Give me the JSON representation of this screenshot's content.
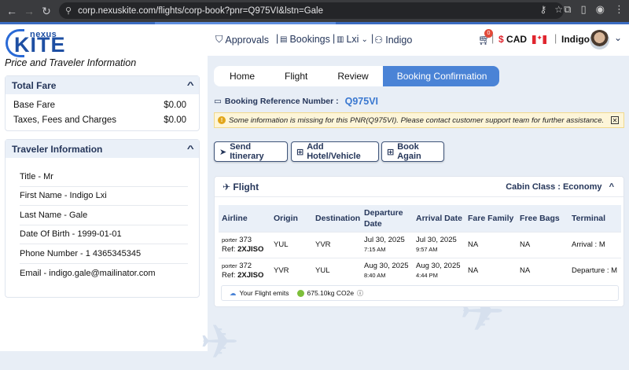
{
  "browser": {
    "url": "corp.nexuskite.com/flights/corp-book?pnr=Q975VI&lstn=Gale"
  },
  "brand": {
    "logo_top": "nexus",
    "logo_main": "KITE"
  },
  "sidebar": {
    "page_title": "Price and Traveler Information",
    "total_fare": {
      "heading": "Total Fare",
      "rows": [
        {
          "label": "Base Fare",
          "value": "$0.00"
        },
        {
          "label": "Taxes, Fees and Charges",
          "value": "$0.00"
        }
      ]
    },
    "traveler": {
      "heading": "Traveler Information",
      "rows": [
        "Title - Mr",
        "First Name - Indigo Lxi",
        "Last Name - Gale",
        "Date Of Birth - 1999-01-01",
        "Phone Number - 1 4365345345",
        "Email - indigo.gale@mailinator.com"
      ]
    }
  },
  "topnav": {
    "approvals": "Approvals",
    "bookings": "Bookings",
    "lxi": "Lxi",
    "indigo": "Indigo",
    "cart_count": "0",
    "currency_symbol": "$",
    "currency": "CAD",
    "user": "Indigo"
  },
  "breadcrumb": [
    "Home",
    "Flight",
    "Review",
    "Booking Confirmation"
  ],
  "booking": {
    "ref_label": "Booking Reference Number :",
    "ref_value": "Q975VI",
    "warning": "Some information is missing for this PNR(Q975VI). Please contact customer support team for further assistance."
  },
  "actions": {
    "send": "Send Itinerary",
    "hotel": "Add Hotel/Vehicle",
    "again": "Book Again"
  },
  "flight": {
    "title": "Flight",
    "cabin": "Cabin Class : Economy",
    "columns": [
      "Airline",
      "Origin",
      "Destination",
      "Departure Date",
      "Arrival Date",
      "Fare Family",
      "Free Bags",
      "Terminal"
    ],
    "rows": [
      {
        "carrier": "porter",
        "number": "373",
        "ref": "Ref:",
        "ref_code": "2XJISO",
        "origin": "YUL",
        "destination": "YVR",
        "dep_date": "Jul 30, 2025",
        "dep_time": "7:15 AM",
        "arr_date": "Jul 30, 2025",
        "arr_time": "9:57 AM",
        "fare": "NA",
        "bags": "NA",
        "terminal": "Arrival : M"
      },
      {
        "carrier": "porter",
        "number": "372",
        "ref": "Ref:",
        "ref_code": "2XJISO",
        "origin": "YVR",
        "destination": "YUL",
        "dep_date": "Aug 30, 2025",
        "dep_time": "8:40 AM",
        "arr_date": "Aug 30, 2025",
        "arr_time": "4:44 PM",
        "fare": "NA",
        "bags": "NA",
        "terminal": "Departure : M"
      }
    ],
    "emits_label": "Your Flight emits",
    "emits_value": "675.10kg CO2e"
  }
}
